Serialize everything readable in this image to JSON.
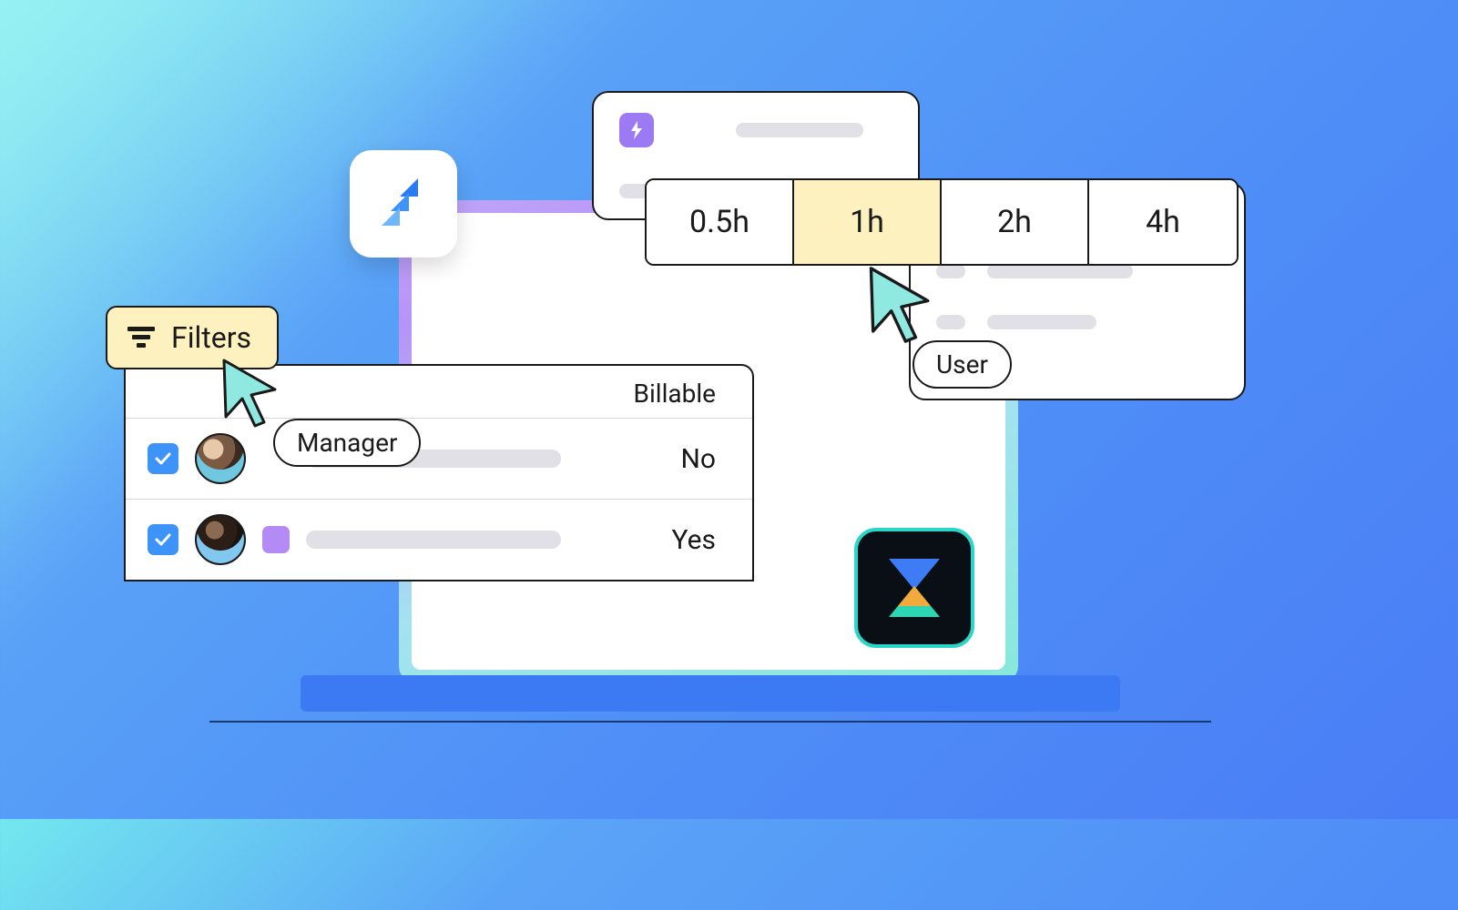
{
  "filters": {
    "label": "Filters"
  },
  "table": {
    "headers": {
      "billable": "Billable"
    },
    "rows": [
      {
        "checked": true,
        "billable": "No"
      },
      {
        "checked": true,
        "billable": "Yes"
      }
    ]
  },
  "cursors": {
    "manager": {
      "label": "Manager"
    },
    "user": {
      "label": "User"
    }
  },
  "time_options": {
    "items": [
      "0.5h",
      "1h",
      "2h",
      "4h"
    ],
    "selected": "1h"
  }
}
